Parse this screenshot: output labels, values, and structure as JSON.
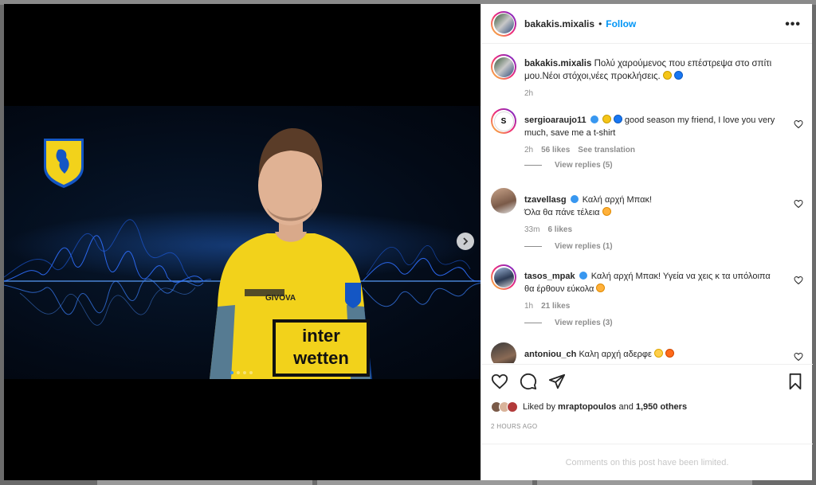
{
  "post": {
    "username": "bakakis.mixalis",
    "separator": "•",
    "follow_label": "Follow",
    "more_label": "•••",
    "caption_user": "bakakis.mixalis",
    "caption_text_line1": "Πολύ χαρούμενος που επέστρεψα στο σπίτι",
    "caption_text_line2": "μου.Νέοι στόχοι,νέες προκλήσεις.",
    "caption_time": "2h",
    "carousel_total_slides": 4,
    "carousel_active_slide": 1
  },
  "jersey": {
    "brand": "GIVOVA",
    "sponsor_line1": "inter",
    "sponsor_line2": "wetten"
  },
  "comments": [
    {
      "user": "sergioaraujo11",
      "verified": true,
      "text_line1": "good season my friend, I love you very",
      "text_line2": "much, save me a t-shirt",
      "time": "2h",
      "likes": "56 likes",
      "extra": "See translation",
      "view_replies": "View replies (5)"
    },
    {
      "user": "tzavellasg",
      "verified": true,
      "text_line1": "Καλή αρχή Μπακ!",
      "text_line2": "Όλα θα πάνε τέλεια",
      "time": "33m",
      "likes": "6 likes",
      "view_replies": "View replies (1)"
    },
    {
      "user": "tasos_mpak",
      "verified": true,
      "text_line1": "Καλή αρχή Μπακ! Υγεία να χεις κ τα υπόλοιπα",
      "text_line2": "θα έρθουν εύκολα",
      "time": "1h",
      "likes": "21 likes",
      "view_replies": "View replies (3)"
    },
    {
      "user": "antoniou_ch",
      "verified": false,
      "text_line1": "Καλη αρχή αδερφε"
    }
  ],
  "likes": {
    "prefix": "Liked by",
    "user": "mraptopoulos",
    "and": "and",
    "others": "1,950 others"
  },
  "timestamp": "2 HOURS AGO",
  "limited_notice": "Comments on this post have been limited.",
  "icons": [
    "heart-icon",
    "comment-icon",
    "share-icon",
    "bookmark-icon",
    "more-icon",
    "chevron-right-icon"
  ],
  "colors": {
    "link_blue": "#0095f6",
    "verified_blue": "#3897f0",
    "jersey_yellow": "#f2d21b",
    "wave_blue": "#1e6bff"
  }
}
